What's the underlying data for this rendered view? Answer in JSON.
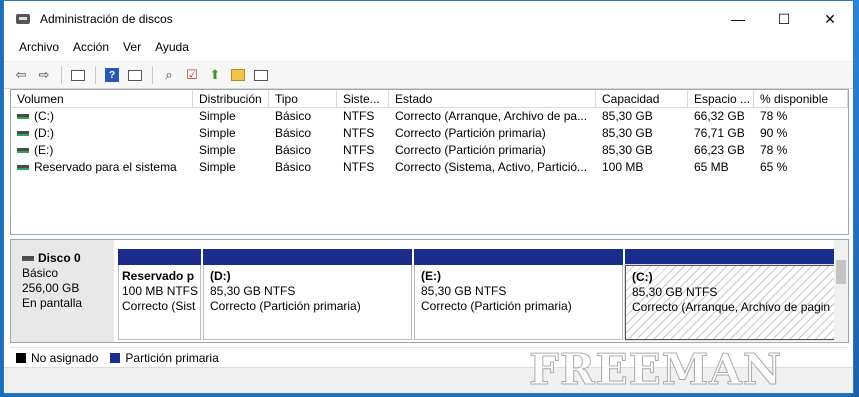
{
  "window": {
    "title": "Administración de discos"
  },
  "titlebar_buttons": {
    "minimize": "—",
    "maximize": "☐",
    "close": "✕"
  },
  "menu": [
    "Archivo",
    "Acción",
    "Ver",
    "Ayuda"
  ],
  "toolbar_icons": [
    "back-icon",
    "forward-icon",
    "console-tree-icon",
    "help-icon",
    "view-icon",
    "connect-icon",
    "check-icon",
    "up-arrow-icon",
    "search-icon",
    "properties-icon"
  ],
  "volumes": {
    "headers": [
      "Volumen",
      "Distribución",
      "Tipo",
      "Siste...",
      "Estado",
      "Capacidad",
      "Espacio ...",
      "% disponible"
    ],
    "rows": [
      [
        "(C:)",
        "Simple",
        "Básico",
        "NTFS",
        "Correcto (Arranque, Archivo de pa...",
        "85,30 GB",
        "66,32 GB",
        "78 %"
      ],
      [
        "(D:)",
        "Simple",
        "Básico",
        "NTFS",
        "Correcto (Partición primaria)",
        "85,30 GB",
        "76,71 GB",
        "90 %"
      ],
      [
        "(E:)",
        "Simple",
        "Básico",
        "NTFS",
        "Correcto (Partición primaria)",
        "85,30 GB",
        "66,23 GB",
        "78 %"
      ],
      [
        "Reservado para el sistema",
        "Simple",
        "Básico",
        "NTFS",
        "Correcto (Sistema, Activo, Partició...",
        "100 MB",
        "65 MB",
        "65 %"
      ]
    ]
  },
  "disk": {
    "name": "Disco 0",
    "type": "Básico",
    "size": "256,00 GB",
    "status": "En pantalla",
    "partitions": [
      {
        "name": "Reservado p",
        "size": "100 MB NTFS",
        "status": "Correcto (Sist"
      },
      {
        "name": "(D:)",
        "size": "85,30 GB NTFS",
        "status": "Correcto (Partición primaria)"
      },
      {
        "name": "(E:)",
        "size": "85,30 GB NTFS",
        "status": "Correcto (Partición primaria)"
      },
      {
        "name": "(C:)",
        "size": "85,30 GB NTFS",
        "status": "Correcto (Arranque, Archivo de pagin"
      }
    ]
  },
  "legend": [
    {
      "label": "No asignado",
      "color": "#000000"
    },
    {
      "label": "Partición primaria",
      "color": "#1a2d8c"
    }
  ],
  "watermark": "FREEMAN"
}
